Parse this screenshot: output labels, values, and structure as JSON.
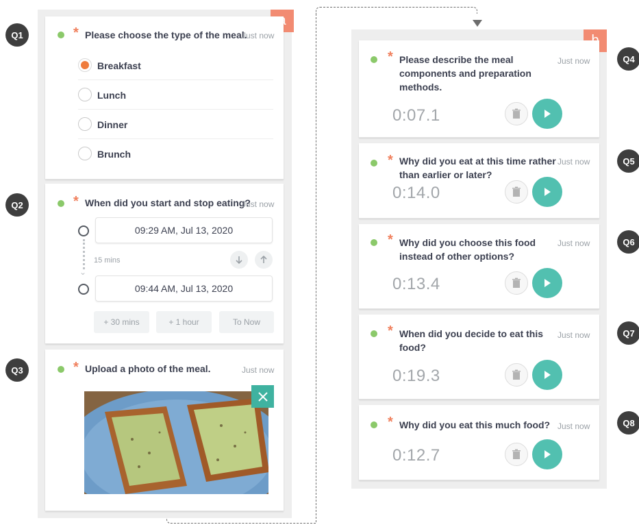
{
  "panel_a": {
    "tag": "a"
  },
  "panel_b": {
    "tag": "b"
  },
  "badges": [
    "Q1",
    "Q2",
    "Q3",
    "Q4",
    "Q5",
    "Q6",
    "Q7",
    "Q8"
  ],
  "q1": {
    "question": "Please choose the type of the meal.",
    "time": "Just now",
    "options": [
      {
        "label": "Breakfast",
        "selected": true
      },
      {
        "label": "Lunch",
        "selected": false
      },
      {
        "label": "Dinner",
        "selected": false
      },
      {
        "label": "Brunch",
        "selected": false
      }
    ]
  },
  "q2": {
    "question": "When did you start and stop eating?",
    "time": "Just now",
    "start": "09:29 AM, Jul 13, 2020",
    "end": "09:44 AM, Jul 13, 2020",
    "duration": "15 mins",
    "buttons": [
      "+ 30 mins",
      "+ 1 hour",
      "To Now"
    ]
  },
  "q3": {
    "question": "Upload a photo of the meal.",
    "time": "Just now"
  },
  "q4": {
    "question_line1": "Please describe the meal",
    "question_line2": "components and preparation",
    "question_line3": "methods.",
    "time": "Just now",
    "timer": "0:07.1"
  },
  "q5": {
    "question_line1": "Why did you eat at this time rather",
    "question_line2": "than earlier or later?",
    "time": "Just now",
    "timer": "0:14.0"
  },
  "q6": {
    "question_line1": "Why did you choose this food",
    "question_line2": "instead of other options?",
    "time": "Just now",
    "timer": "0:13.4"
  },
  "q7": {
    "question_line1": "When did you decide to eat this",
    "question_line2": "food?",
    "time": "Just now",
    "timer": "0:19.3"
  },
  "q8": {
    "question_line1": "Why did you eat this much food?",
    "time": "Just now",
    "timer": "0:12.7"
  },
  "colors": {
    "accent_orange": "#f07f5c",
    "tag_salmon": "#f28b72",
    "teal": "#52c0b0",
    "status_green": "#8bc96a",
    "badge_dark": "#3e3e3e"
  }
}
